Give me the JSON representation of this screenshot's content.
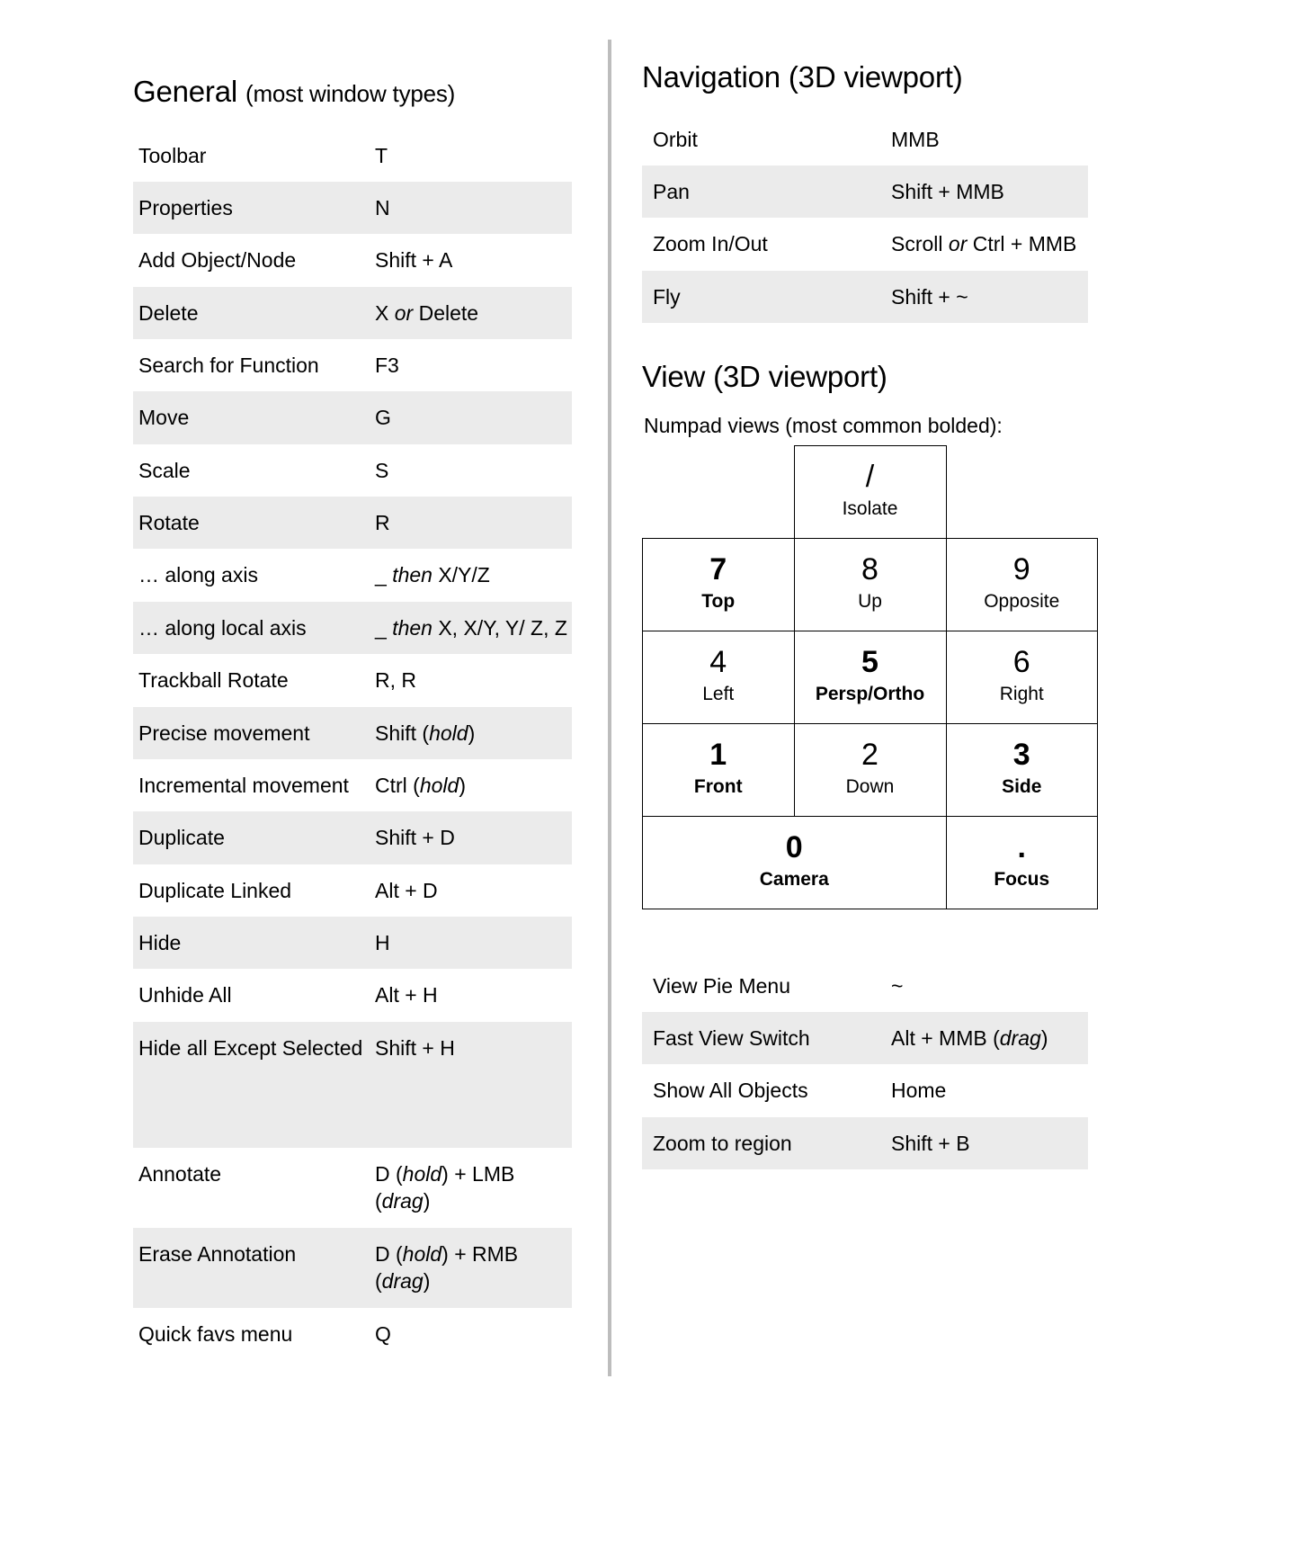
{
  "general": {
    "title": "General",
    "title_sub": "(most window types)",
    "rows": [
      {
        "action": "Toolbar",
        "shortcut": "T"
      },
      {
        "action": "Properties",
        "shortcut": "N"
      },
      {
        "action": "Add Object/Node",
        "shortcut": "Shift + A"
      },
      {
        "action": "Delete",
        "shortcut": "X or Delete",
        "shortcut_parts": [
          {
            "t": "X ",
            "i": false
          },
          {
            "t": "or",
            "i": true
          },
          {
            "t": " Delete",
            "i": false
          }
        ]
      },
      {
        "action": "Search for Function",
        "shortcut": "F3"
      },
      {
        "action": "Move",
        "shortcut": "G"
      },
      {
        "action": "Scale",
        "shortcut": "S"
      },
      {
        "action": "Rotate",
        "shortcut": "R"
      },
      {
        "action": "… along axis",
        "shortcut": "_ then X/Y/Z",
        "shortcut_parts": [
          {
            "t": "_ ",
            "i": false
          },
          {
            "t": "then",
            "i": true
          },
          {
            "t": " X/Y/Z",
            "i": false
          }
        ]
      },
      {
        "action": "… along local axis",
        "shortcut": "_ then X, X/Y, Y/ Z, Z",
        "shortcut_parts": [
          {
            "t": "_ ",
            "i": false
          },
          {
            "t": "then",
            "i": true
          },
          {
            "t": " X, X/Y, Y/ Z, Z",
            "i": false
          }
        ]
      },
      {
        "action": "Trackball Rotate",
        "shortcut": "R, R"
      },
      {
        "action": "Precise movement",
        "shortcut": "Shift (hold)",
        "shortcut_parts": [
          {
            "t": "Shift (",
            "i": false
          },
          {
            "t": "hold",
            "i": true
          },
          {
            "t": ")",
            "i": false
          }
        ]
      },
      {
        "action": "Incremental movement",
        "shortcut": "Ctrl (hold)",
        "shortcut_parts": [
          {
            "t": "Ctrl (",
            "i": false
          },
          {
            "t": "hold",
            "i": true
          },
          {
            "t": ")",
            "i": false
          }
        ]
      },
      {
        "action": "Duplicate",
        "shortcut": "Shift + D"
      },
      {
        "action": "Duplicate Linked",
        "shortcut": "Alt + D"
      },
      {
        "action": "Hide",
        "shortcut": "H"
      },
      {
        "action": "Unhide All",
        "shortcut": "Alt + H"
      },
      {
        "action": "Hide all Except Selected",
        "shortcut": "Shift + H"
      },
      {
        "action": "Annotate",
        "shortcut": "D (hold) + LMB (drag)",
        "shortcut_parts": [
          {
            "t": "D (",
            "i": false
          },
          {
            "t": "hold",
            "i": true
          },
          {
            "t": ") + LMB (",
            "i": false
          },
          {
            "t": "drag",
            "i": true
          },
          {
            "t": ")",
            "i": false
          }
        ]
      },
      {
        "action": "Erase Annotation",
        "shortcut": "D (hold) + RMB (drag)",
        "shortcut_parts": [
          {
            "t": "D (",
            "i": false
          },
          {
            "t": "hold",
            "i": true
          },
          {
            "t": ") + RMB (",
            "i": false
          },
          {
            "t": "drag",
            "i": true
          },
          {
            "t": ")",
            "i": false
          }
        ]
      },
      {
        "action": "Quick favs menu",
        "shortcut": "Q"
      }
    ]
  },
  "navigation": {
    "title": "Navigation (3D viewport)",
    "rows": [
      {
        "action": "Orbit",
        "shortcut": "MMB"
      },
      {
        "action": "Pan",
        "shortcut": "Shift + MMB"
      },
      {
        "action": "Zoom In/Out",
        "shortcut": "Scroll or Ctrl + MMB",
        "shortcut_parts": [
          {
            "t": "Scroll ",
            "i": false
          },
          {
            "t": "or",
            "i": true
          },
          {
            "t": " Ctrl + MMB",
            "i": false
          }
        ]
      },
      {
        "action": "Fly",
        "shortcut": "Shift + ~"
      }
    ]
  },
  "view": {
    "title": "View (3D viewport)",
    "note": "Numpad views (most common bolded):",
    "numpad": {
      "isolate": {
        "key": "/",
        "label": "Isolate",
        "bold_key": false,
        "bold_label": false
      },
      "cells": [
        {
          "key": "7",
          "label": "Top",
          "bold_key": true,
          "bold_label": true
        },
        {
          "key": "8",
          "label": "Up",
          "bold_key": false,
          "bold_label": false
        },
        {
          "key": "9",
          "label": "Opposite",
          "bold_key": false,
          "bold_label": false
        },
        {
          "key": "4",
          "label": "Left",
          "bold_key": false,
          "bold_label": false
        },
        {
          "key": "5",
          "label": "Persp/Ortho",
          "bold_key": true,
          "bold_label": true
        },
        {
          "key": "6",
          "label": "Right",
          "bold_key": false,
          "bold_label": false
        },
        {
          "key": "1",
          "label": "Front",
          "bold_key": true,
          "bold_label": true
        },
        {
          "key": "2",
          "label": "Down",
          "bold_key": false,
          "bold_label": false
        },
        {
          "key": "3",
          "label": "Side",
          "bold_key": true,
          "bold_label": true
        }
      ],
      "camera": {
        "key": "0",
        "label": "Camera",
        "bold_key": true,
        "bold_label": true
      },
      "focus": {
        "key": ".",
        "label": "Focus",
        "bold_key": true,
        "bold_label": true
      }
    },
    "rows": [
      {
        "action": "View Pie Menu",
        "shortcut": "~"
      },
      {
        "action": "Fast View Switch",
        "shortcut": "Alt + MMB (drag)",
        "shortcut_parts": [
          {
            "t": "Alt + MMB (",
            "i": false
          },
          {
            "t": "drag",
            "i": true
          },
          {
            "t": ")",
            "i": false
          }
        ]
      },
      {
        "action": "Show All Objects",
        "shortcut": "Home"
      },
      {
        "action": "Zoom to region",
        "shortcut": "Shift + B"
      }
    ]
  },
  "colors": {
    "zebra": "#ebebeb",
    "divider": "#bdbdbd",
    "text": "#000000",
    "border": "#000000"
  }
}
